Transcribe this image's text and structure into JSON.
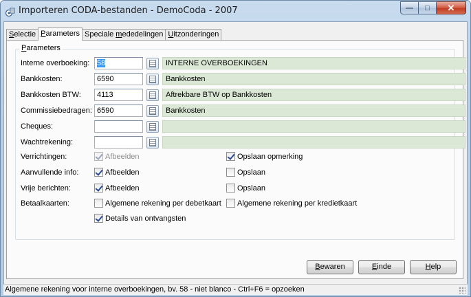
{
  "window": {
    "title": "Importeren CODA-bestanden - DemoCoda - 2007",
    "min_label": "—",
    "max_label": "□",
    "close_label": "✕"
  },
  "tabs": [
    {
      "pre": "",
      "accel": "S",
      "post": "electie"
    },
    {
      "pre": "",
      "accel": "P",
      "post": "arameters"
    },
    {
      "pre": "Speciale ",
      "accel": "m",
      "post": "ededelingen"
    },
    {
      "pre": "",
      "accel": "U",
      "post": "itzonderingen"
    }
  ],
  "group": {
    "accel": "P",
    "post": "arameters"
  },
  "accounts": [
    {
      "label": "Interne overboeking:",
      "code": "58",
      "selected": true,
      "description": "INTERNE OVERBOEKINGEN"
    },
    {
      "label": "Bankkosten:",
      "code": "6590",
      "selected": false,
      "description": "Bankkosten"
    },
    {
      "label": "Bankkosten BTW:",
      "code": "4113",
      "selected": false,
      "description": "Aftrekbare BTW op Bankkosten"
    },
    {
      "label": "Commissiebedragen:",
      "code": "6590",
      "selected": false,
      "description": "Bankkosten"
    },
    {
      "label": "Cheques:",
      "code": "",
      "selected": false,
      "description": ""
    },
    {
      "label": "Wachtrekening:",
      "code": "",
      "selected": false,
      "description": ""
    }
  ],
  "options": [
    {
      "label": "Verrichtingen:",
      "a_label": "Afbeelden",
      "a_checked": true,
      "a_disabled": true,
      "b_label": "Opslaan opmerking",
      "b_checked": true
    },
    {
      "label": "Aanvullende info:",
      "a_label": "Afbeelden",
      "a_checked": true,
      "a_disabled": false,
      "b_label": "Opslaan",
      "b_checked": false
    },
    {
      "label": "Vrije berichten:",
      "a_label": "Afbeelden",
      "a_checked": true,
      "a_disabled": false,
      "b_label": "Opslaan",
      "b_checked": false
    },
    {
      "label": "Betaalkaarten:",
      "a_label": "Algemene rekening per debetkaart",
      "a_checked": false,
      "a_disabled": false,
      "b_label": "Algemene rekening per kredietkaart",
      "b_checked": false
    }
  ],
  "details": {
    "label": "Details van ontvangsten",
    "checked": true
  },
  "buttons": {
    "save": {
      "accel": "B",
      "post": "ewaren"
    },
    "close": {
      "accel": "E",
      "post": "inde"
    },
    "help": {
      "accel": "H",
      "post": "elp"
    }
  },
  "status": "Algemene rekening voor interne overboekingen, bv. 58 - niet blanco - Ctrl+F6 = opzoeken"
}
